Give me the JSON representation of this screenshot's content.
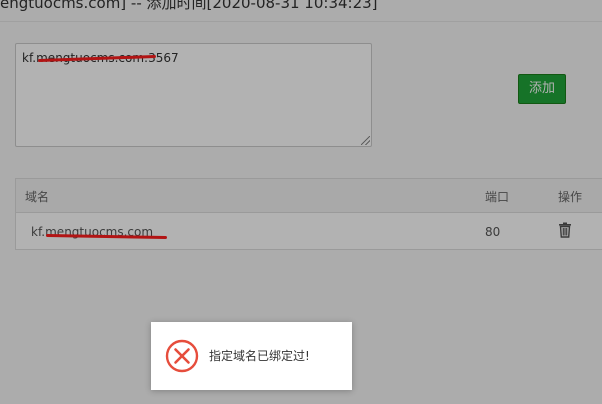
{
  "window": {
    "title": "engtuocms.com] -- 添加时间[2020-08-31 10:34:23]"
  },
  "form": {
    "textarea_value": "kf.mengtuocms.com:3567",
    "add_button_label": "添加"
  },
  "table": {
    "columns": [
      "域名",
      "端口",
      "操作"
    ],
    "rows": [
      {
        "domain": "kf.mengtuocms.com",
        "port": "80",
        "action_icon": "trash-icon"
      }
    ]
  },
  "toast": {
    "icon": "error-circle-x-icon",
    "message": "指定域名已绑定过!",
    "color": "#e64d3c"
  },
  "colors": {
    "add_button": "#20a53a",
    "redaction": "#ff1e1e"
  }
}
